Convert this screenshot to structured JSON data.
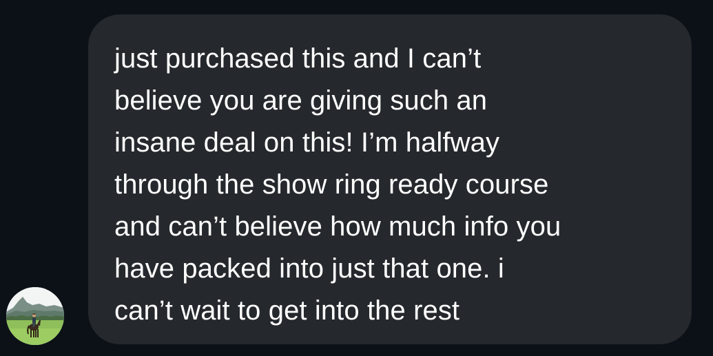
{
  "conversation": {
    "sender": {
      "avatar_icon": "profile-photo-horse-rider"
    },
    "message": {
      "text": "just purchased this and I can’t\nbelieve you are giving such an\ninsane deal on this! I’m halfway\nthrough the show ring ready course\nand can’t believe how much info you\nhave packed into just that one. i\ncan’t wait to get into the rest"
    }
  },
  "colors": {
    "background": "#0c1117",
    "bubble": "#25282c",
    "text": "#ffffff"
  }
}
